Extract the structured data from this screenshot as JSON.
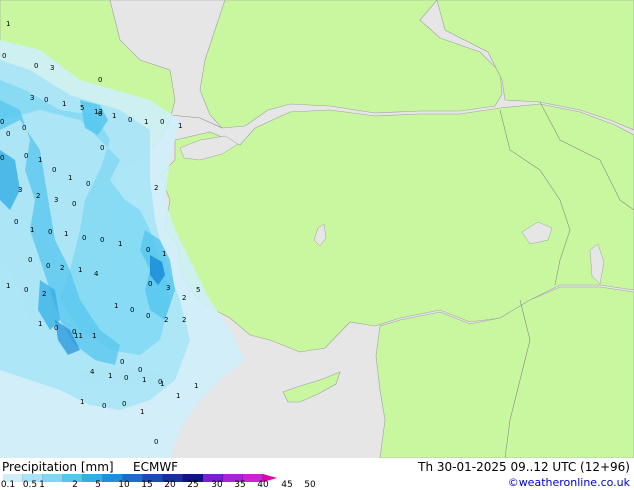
{
  "footer": {
    "title": "Precipitation [mm]",
    "model": "ECMWF",
    "datetime": "Th 30-01-2025 09..12 UTC (12+96)",
    "credit": "©weatheronline.co.uk"
  },
  "legend": {
    "ticks": [
      "0.1",
      "0.5",
      "1",
      "2",
      "5",
      "10",
      "15",
      "20",
      "25",
      "30",
      "35",
      "40",
      "45",
      "50"
    ],
    "colors": [
      "#cfeefa",
      "#a6e4f7",
      "#7fd8f3",
      "#55c6ee",
      "#34aee6",
      "#1f8fd9",
      "#1c6cc9",
      "#1d4bb3",
      "#1a2f99",
      "#0f1480",
      "#7a20d0",
      "#a626d6",
      "#cc22d0",
      "#e000b0"
    ]
  },
  "map": {
    "colors": {
      "sea": "#e6e6e6",
      "land": "#c8f7a0",
      "border": "#8a8a8a"
    },
    "values": [
      "1",
      "0",
      "3",
      "0",
      "0",
      "3",
      "0",
      "1",
      "5",
      "0",
      "12",
      "1",
      "0",
      "1",
      "0",
      "1",
      "0",
      "0",
      "0",
      "0",
      "1",
      "0",
      "0",
      "1",
      "0",
      "0",
      "3",
      "2",
      "3",
      "0",
      "2",
      "0",
      "1",
      "0",
      "1",
      "0",
      "0",
      "1",
      "0",
      "1",
      "0",
      "0",
      "2",
      "1",
      "4",
      "1",
      "0",
      "2",
      "0",
      "3",
      "2",
      "5",
      "1",
      "0",
      "0",
      "2",
      "2",
      "1",
      "0",
      "0",
      "1",
      "11",
      "0",
      "0",
      "0",
      "1",
      "4",
      "1",
      "0",
      "1",
      "1",
      "1",
      "1",
      "0",
      "0",
      "1",
      "0"
    ]
  }
}
